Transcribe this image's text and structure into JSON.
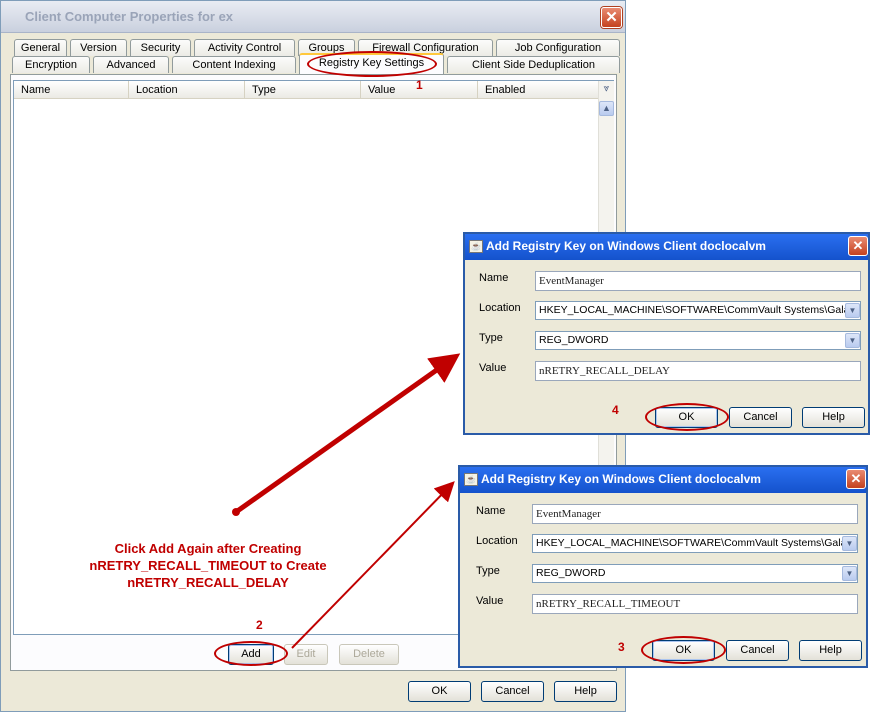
{
  "main_window": {
    "title": "Client Computer Properties for ex",
    "close_glyph": "✕",
    "tabs_row1": [
      "General",
      "Version",
      "Security",
      "Activity Control",
      "Groups",
      "Firewall Configuration",
      "Job Configuration"
    ],
    "tabs_row2": [
      "Encryption",
      "Advanced",
      "Content Indexing",
      "Registry Key Settings",
      "Client Side Deduplication"
    ],
    "active_tab": "Registry Key Settings",
    "table_columns": [
      "Name",
      "Location",
      "Type",
      "Value",
      "Enabled"
    ],
    "buttons": {
      "add": "Add",
      "edit": "Edit",
      "delete": "Delete",
      "ok": "OK",
      "cancel": "Cancel",
      "help": "Help"
    }
  },
  "dialogs": [
    {
      "title": "Add Registry Key on Windows Client  doclocalvm",
      "labels": {
        "name": "Name",
        "location": "Location",
        "type": "Type",
        "value": "Value"
      },
      "name": "EventManager",
      "location": "HKEY_LOCAL_MACHINE\\SOFTWARE\\CommVault Systems\\Galaxy",
      "type": "REG_DWORD",
      "value": "nRETRY_RECALL_DELAY",
      "buttons": {
        "ok": "OK",
        "cancel": "Cancel",
        "help": "Help"
      }
    },
    {
      "title": "Add Registry Key on Windows Client  doclocalvm",
      "labels": {
        "name": "Name",
        "location": "Location",
        "type": "Type",
        "value": "Value"
      },
      "name": "EventManager",
      "location": "HKEY_LOCAL_MACHINE\\SOFTWARE\\CommVault Systems\\Galaxy",
      "type": "REG_DWORD",
      "value": "nRETRY_RECALL_TIMEOUT",
      "buttons": {
        "ok": "OK",
        "cancel": "Cancel",
        "help": "Help"
      }
    }
  ],
  "annotations": {
    "step1": "1",
    "step2": "2",
    "step3": "3",
    "step4": "4",
    "callout_line1": "Click Add Again after Creating",
    "callout_line2": "nRETRY_RECALL_TIMEOUT to Create",
    "callout_line3": "nRETRY_RECALL_DELAY",
    "color": "#c00000"
  },
  "icons": {
    "close": "close-icon",
    "chevron_down": "chevron-down-icon",
    "scroll_up": "scroll-up-icon",
    "java_app": "java-app-icon"
  }
}
